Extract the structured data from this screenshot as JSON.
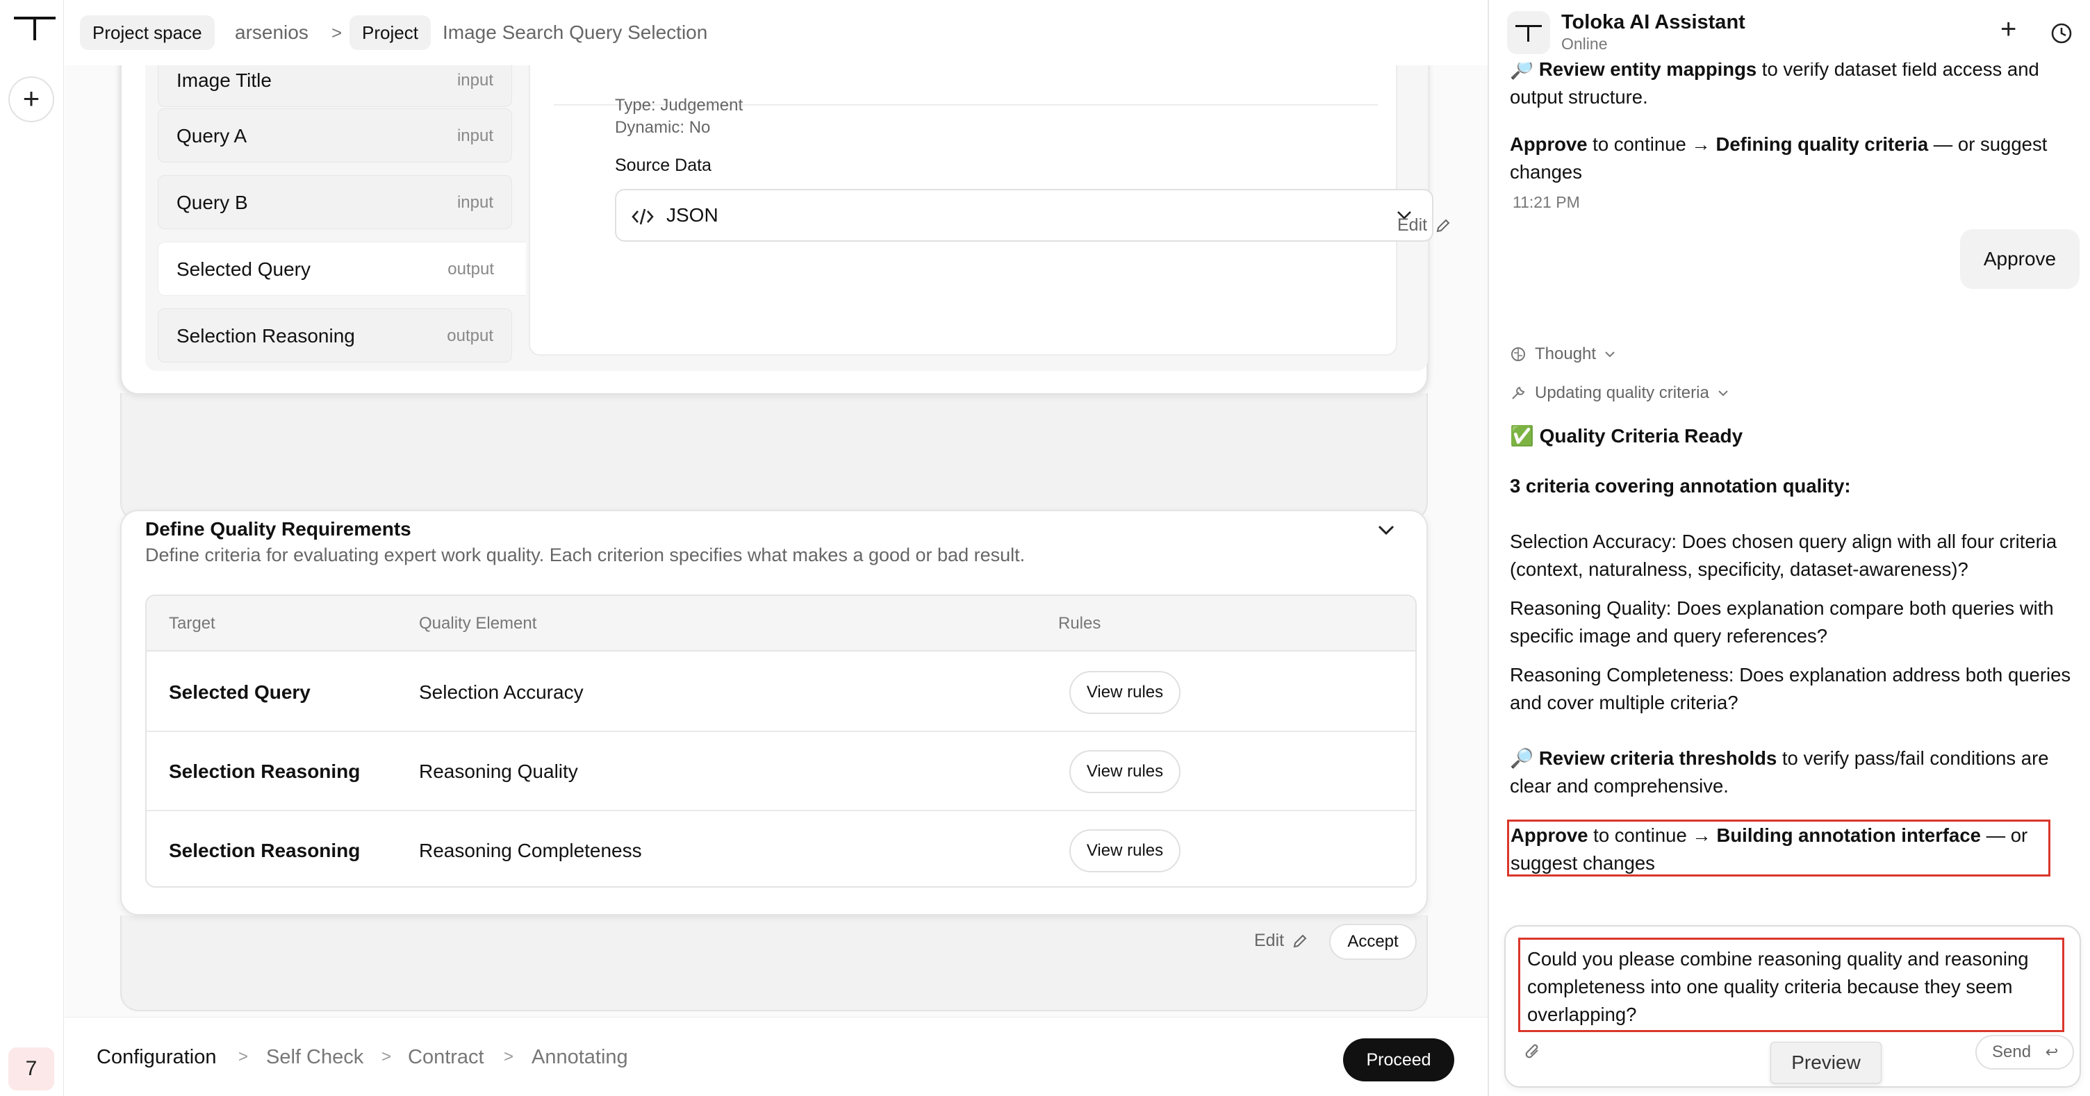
{
  "rail": {
    "badge": "7"
  },
  "breadcrumb": {
    "space_chip": "Project space",
    "space_name": "arsenios",
    "sep": ">",
    "project_chip": "Project",
    "project_name": "Image Search Query Selection"
  },
  "fields": [
    {
      "name": "Image Title",
      "type": "input"
    },
    {
      "name": "Query A",
      "type": "input"
    },
    {
      "name": "Query B",
      "type": "input"
    },
    {
      "name": "Selected Query",
      "type": "output"
    },
    {
      "name": "Selection Reasoning",
      "type": "output"
    }
  ],
  "field_detail": {
    "type_line": "Type: Judgement",
    "dynamic_line": "Dynamic: No",
    "source_label": "Source Data",
    "source_value": "JSON"
  },
  "edit_label": "Edit",
  "quality": {
    "title": "Define Quality Requirements",
    "subtitle": "Define criteria for evaluating expert work quality. Each criterion specifies what makes a good or bad result.",
    "columns": [
      "Target",
      "Quality Element",
      "Rules"
    ],
    "rows": [
      {
        "target": "Selected Query",
        "element": "Selection Accuracy",
        "button": "View rules"
      },
      {
        "target": "Selection Reasoning",
        "element": "Reasoning Quality",
        "button": "View rules"
      },
      {
        "target": "Selection Reasoning",
        "element": "Reasoning Completeness",
        "button": "View rules"
      }
    ],
    "accept_label": "Accept"
  },
  "steps": [
    "Configuration",
    "Self Check",
    "Contract",
    "Annotating"
  ],
  "step_sep": ">",
  "proceed_label": "Proceed",
  "chat": {
    "title": "Toloka AI Assistant",
    "status": "Online",
    "top_partial_bold": "Review entity mappings",
    "top_partial_rest": " to verify dataset field access and",
    "top_partial_line2": "output structure.",
    "approve1_bold": "Approve",
    "approve1_mid": " to continue → ",
    "approve1_bold2": "Defining quality criteria",
    "approve1_rest": " — or suggest changes",
    "time": "11:21 PM",
    "user_msg": "Approve",
    "thought_label": "Thought",
    "updating_label": "Updating quality criteria",
    "ready_emoji": "✅",
    "ready_title": "Quality Criteria Ready",
    "criteria_heading": "3 criteria covering annotation quality:",
    "criteria": [
      "Selection Accuracy: Does chosen query align with all four criteria (context, naturalness, specificity, dataset-awareness)?",
      "Reasoning Quality: Does explanation compare both queries with specific image and query references?",
      "Reasoning Completeness: Does explanation address both queries and cover multiple criteria?"
    ],
    "review_emoji": "🔎",
    "review_bold": "Review criteria thresholds",
    "review_rest": " to verify pass/fail conditions are clear and comprehensive.",
    "approve2_bold": "Approve",
    "approve2_mid": " to continue → ",
    "approve2_bold2": "Building annotation interface",
    "approve2_rest": " — or suggest changes",
    "composer_text": "Could you please combine reasoning quality and reasoning completeness into one quality criteria because they seem overlapping?",
    "send_label": "Send",
    "send_key": "↩",
    "preview_tooltip": "Preview"
  },
  "colors": {
    "highlight": "#d9372b",
    "proceed_bg": "#111111",
    "badge_bg": "#fce8e8"
  }
}
